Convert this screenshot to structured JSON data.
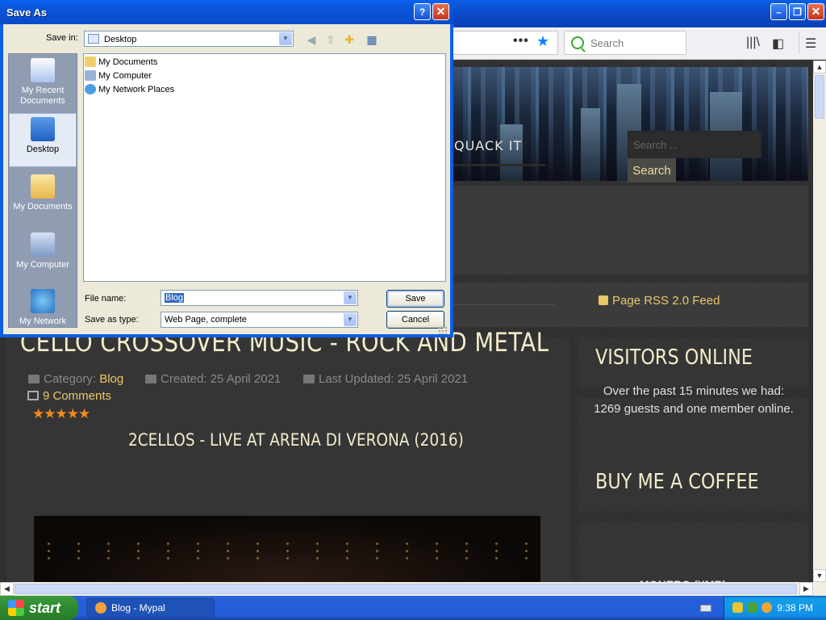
{
  "dialog": {
    "title": "Save As",
    "save_in_label": "Save in:",
    "save_in_value": "Desktop",
    "places": [
      {
        "label": "My Recent Documents",
        "icon": "recent-documents-icon"
      },
      {
        "label": "Desktop",
        "icon": "desktop-icon"
      },
      {
        "label": "My Documents",
        "icon": "my-documents-icon"
      },
      {
        "label": "My Computer",
        "icon": "my-computer-icon"
      },
      {
        "label": "My Network",
        "icon": "my-network-icon"
      }
    ],
    "files": [
      {
        "name": "My Documents",
        "icon": "folder-icon"
      },
      {
        "name": "My Computer",
        "icon": "computer-icon"
      },
      {
        "name": "My Network Places",
        "icon": "network-icon"
      }
    ],
    "file_name_label": "File name:",
    "file_name_value": "Blog",
    "save_type_label": "Save as type:",
    "save_type_value": "Web Page, complete",
    "save_button": "Save",
    "cancel_button": "Cancel",
    "help_button": "?",
    "close_button": "✕"
  },
  "browser": {
    "search_placeholder": "Search",
    "url_dots": "•••"
  },
  "page": {
    "nav_link": "QUACK IT",
    "site_search_placeholder": "Search ...",
    "site_search_button": "Search",
    "article": {
      "title": "CELLO CROSSOVER MUSIC - ROCK AND METAL",
      "category_label": "Category:",
      "category_value": "Blog",
      "created": "Created: 25 April 2021",
      "updated": "Last Updated: 25 April 2021",
      "comments": "9 Comments",
      "rating_stars": "★★★★★",
      "video_title": "2CELLOS - LIVE AT ARENA DI VERONA (2016)"
    },
    "sidebar": {
      "rss": "Page RSS 2.0 Feed",
      "visitors_title": "VISITORS ONLINE",
      "visitors_text": "Over the past 15 minutes we had: 1269 guests and one member online.",
      "coffee_title": "BUY ME A COFFEE",
      "monero": "MONERO (XMR)"
    }
  },
  "taskbar": {
    "start": "start",
    "task_item": "Blog - Mypal",
    "clock": "9:38 PM"
  },
  "colors": {
    "xp_blue": "#0a55d8",
    "link_gold": "#e9c86a",
    "heading_cream": "#f3eccb",
    "star_orange": "#f08b1b"
  }
}
